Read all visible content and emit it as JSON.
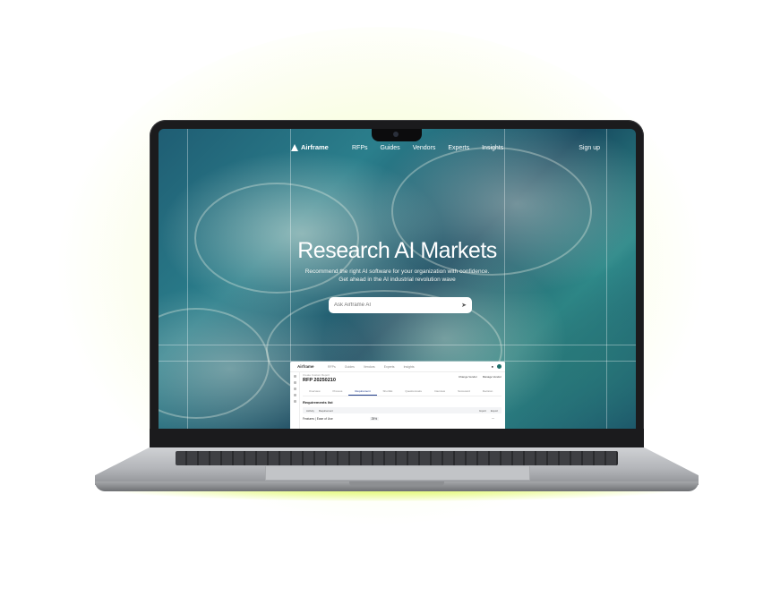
{
  "site": {
    "brand": "Airframe",
    "nav": [
      "RFPs",
      "Guides",
      "Vendors",
      "Experts",
      "Insights"
    ],
    "signup": "Sign up"
  },
  "hero": {
    "title": "Research AI Markets",
    "subtitle_line1": "Recommend the right AI software for your organization with confidence.",
    "subtitle_line2": "Get ahead in the AI industrial revolution wave",
    "search_placeholder": "Ask Airframe AI"
  },
  "app_preview": {
    "brand": "Airframe",
    "nav": [
      "RFPs",
      "Guides",
      "Vendors",
      "Experts",
      "Insights"
    ],
    "breadcrumb": "Create Custom Report",
    "rfp_id": "RFP 20250210",
    "actions": [
      "Change Vendor",
      "Manage Vendor"
    ],
    "tabs": [
      "Overview",
      "Process",
      "Requirement",
      "Shortlist",
      "Questionnaire",
      "Interview",
      "Scorecard",
      "Decision"
    ],
    "active_tab": "Requirement",
    "section_title": "Requirements list",
    "toolbar_left": [
      "Activity",
      "Requirement"
    ],
    "toolbar_right": [
      "Import",
      "Export"
    ],
    "feature_row": "Features | Ease of Use",
    "feature_pct": "25%"
  },
  "colors": {
    "glow": "#e8fa8c",
    "accent": "#1e6e6a",
    "tab_active": "#1e3a8a"
  }
}
